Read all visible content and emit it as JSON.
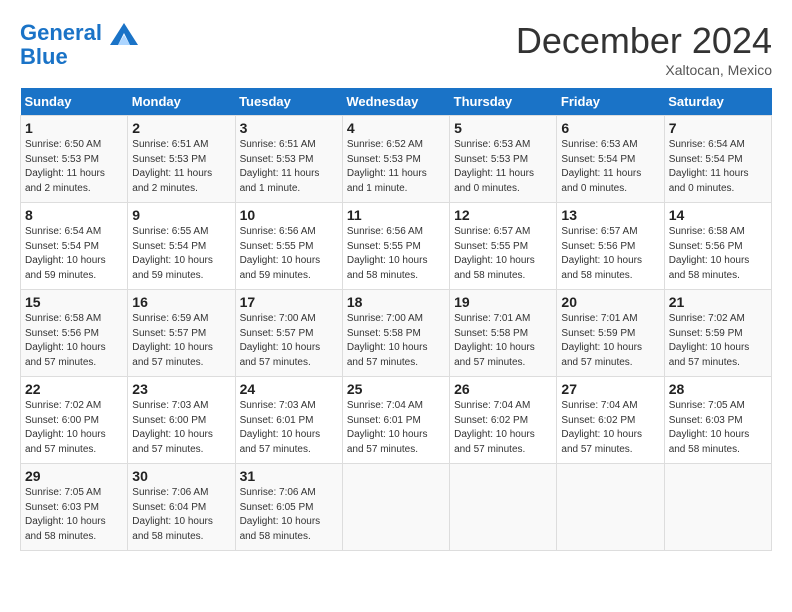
{
  "header": {
    "logo_line1": "General",
    "logo_line2": "Blue",
    "month": "December 2024",
    "location": "Xaltocan, Mexico"
  },
  "days_of_week": [
    "Sunday",
    "Monday",
    "Tuesday",
    "Wednesday",
    "Thursday",
    "Friday",
    "Saturday"
  ],
  "weeks": [
    [
      {
        "num": "1",
        "sunrise": "6:50 AM",
        "sunset": "5:53 PM",
        "daylight": "11 hours and 2 minutes."
      },
      {
        "num": "2",
        "sunrise": "6:51 AM",
        "sunset": "5:53 PM",
        "daylight": "11 hours and 2 minutes."
      },
      {
        "num": "3",
        "sunrise": "6:51 AM",
        "sunset": "5:53 PM",
        "daylight": "11 hours and 1 minute."
      },
      {
        "num": "4",
        "sunrise": "6:52 AM",
        "sunset": "5:53 PM",
        "daylight": "11 hours and 1 minute."
      },
      {
        "num": "5",
        "sunrise": "6:53 AM",
        "sunset": "5:53 PM",
        "daylight": "11 hours and 0 minutes."
      },
      {
        "num": "6",
        "sunrise": "6:53 AM",
        "sunset": "5:54 PM",
        "daylight": "11 hours and 0 minutes."
      },
      {
        "num": "7",
        "sunrise": "6:54 AM",
        "sunset": "5:54 PM",
        "daylight": "11 hours and 0 minutes."
      }
    ],
    [
      {
        "num": "8",
        "sunrise": "6:54 AM",
        "sunset": "5:54 PM",
        "daylight": "10 hours and 59 minutes."
      },
      {
        "num": "9",
        "sunrise": "6:55 AM",
        "sunset": "5:54 PM",
        "daylight": "10 hours and 59 minutes."
      },
      {
        "num": "10",
        "sunrise": "6:56 AM",
        "sunset": "5:55 PM",
        "daylight": "10 hours and 59 minutes."
      },
      {
        "num": "11",
        "sunrise": "6:56 AM",
        "sunset": "5:55 PM",
        "daylight": "10 hours and 58 minutes."
      },
      {
        "num": "12",
        "sunrise": "6:57 AM",
        "sunset": "5:55 PM",
        "daylight": "10 hours and 58 minutes."
      },
      {
        "num": "13",
        "sunrise": "6:57 AM",
        "sunset": "5:56 PM",
        "daylight": "10 hours and 58 minutes."
      },
      {
        "num": "14",
        "sunrise": "6:58 AM",
        "sunset": "5:56 PM",
        "daylight": "10 hours and 58 minutes."
      }
    ],
    [
      {
        "num": "15",
        "sunrise": "6:58 AM",
        "sunset": "5:56 PM",
        "daylight": "10 hours and 57 minutes."
      },
      {
        "num": "16",
        "sunrise": "6:59 AM",
        "sunset": "5:57 PM",
        "daylight": "10 hours and 57 minutes."
      },
      {
        "num": "17",
        "sunrise": "7:00 AM",
        "sunset": "5:57 PM",
        "daylight": "10 hours and 57 minutes."
      },
      {
        "num": "18",
        "sunrise": "7:00 AM",
        "sunset": "5:58 PM",
        "daylight": "10 hours and 57 minutes."
      },
      {
        "num": "19",
        "sunrise": "7:01 AM",
        "sunset": "5:58 PM",
        "daylight": "10 hours and 57 minutes."
      },
      {
        "num": "20",
        "sunrise": "7:01 AM",
        "sunset": "5:59 PM",
        "daylight": "10 hours and 57 minutes."
      },
      {
        "num": "21",
        "sunrise": "7:02 AM",
        "sunset": "5:59 PM",
        "daylight": "10 hours and 57 minutes."
      }
    ],
    [
      {
        "num": "22",
        "sunrise": "7:02 AM",
        "sunset": "6:00 PM",
        "daylight": "10 hours and 57 minutes."
      },
      {
        "num": "23",
        "sunrise": "7:03 AM",
        "sunset": "6:00 PM",
        "daylight": "10 hours and 57 minutes."
      },
      {
        "num": "24",
        "sunrise": "7:03 AM",
        "sunset": "6:01 PM",
        "daylight": "10 hours and 57 minutes."
      },
      {
        "num": "25",
        "sunrise": "7:04 AM",
        "sunset": "6:01 PM",
        "daylight": "10 hours and 57 minutes."
      },
      {
        "num": "26",
        "sunrise": "7:04 AM",
        "sunset": "6:02 PM",
        "daylight": "10 hours and 57 minutes."
      },
      {
        "num": "27",
        "sunrise": "7:04 AM",
        "sunset": "6:02 PM",
        "daylight": "10 hours and 57 minutes."
      },
      {
        "num": "28",
        "sunrise": "7:05 AM",
        "sunset": "6:03 PM",
        "daylight": "10 hours and 58 minutes."
      }
    ],
    [
      {
        "num": "29",
        "sunrise": "7:05 AM",
        "sunset": "6:03 PM",
        "daylight": "10 hours and 58 minutes."
      },
      {
        "num": "30",
        "sunrise": "7:06 AM",
        "sunset": "6:04 PM",
        "daylight": "10 hours and 58 minutes."
      },
      {
        "num": "31",
        "sunrise": "7:06 AM",
        "sunset": "6:05 PM",
        "daylight": "10 hours and 58 minutes."
      },
      null,
      null,
      null,
      null
    ]
  ]
}
